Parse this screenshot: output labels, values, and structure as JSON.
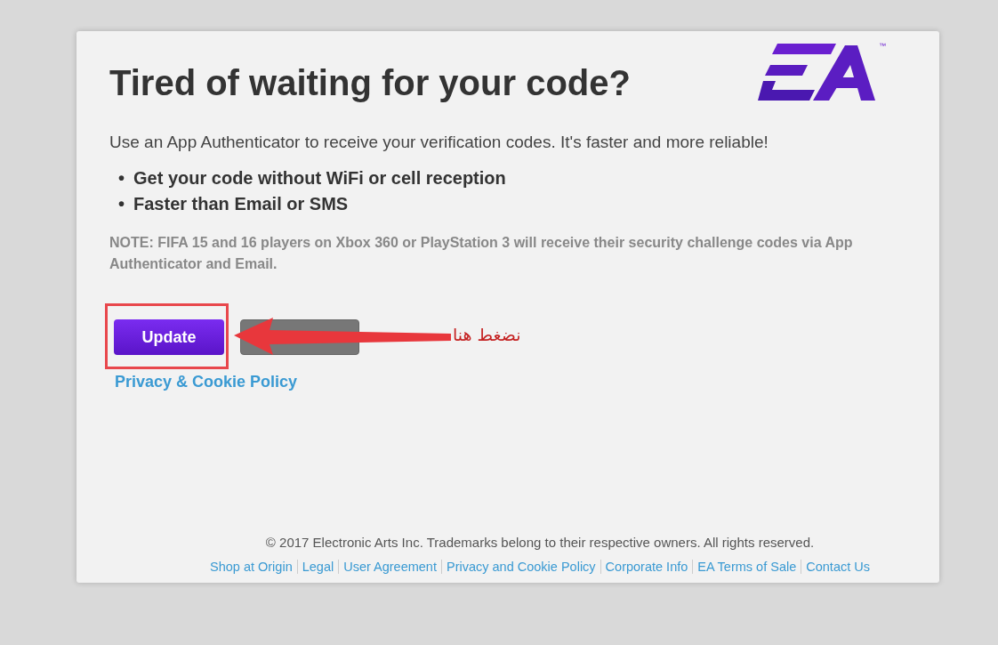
{
  "dialog": {
    "title": "Tired of waiting for your code?",
    "logo_trademark": "™",
    "intro": "Use an App Authenticator to receive your verification codes. It's faster and more reliable!",
    "bullets": [
      {
        "marker": "•",
        "text": "Get your code without WiFi or cell reception"
      },
      {
        "marker": "•",
        "text": "Faster than Email or SMS"
      }
    ],
    "note": "NOTE: FIFA 15 and 16 players on Xbox 360 or PlayStation 3 will receive their security challenge codes via App Authenticator and Email.",
    "buttons": [
      {
        "label": "Update",
        "kind": "primary"
      },
      {
        "kind": "secondary"
      }
    ],
    "policy_link": "Privacy & Cookie Policy"
  },
  "annotation": {
    "text": "نضغط هنا"
  },
  "footer": {
    "copyright": "© 2017 Electronic Arts Inc. Trademarks belong to their respective owners. All rights reserved.",
    "links": [
      "Shop at Origin",
      "Legal",
      "User Agreement",
      "Privacy and Cookie Policy",
      "Corporate Info",
      "EA Terms of Sale",
      "Contact Us"
    ]
  }
}
